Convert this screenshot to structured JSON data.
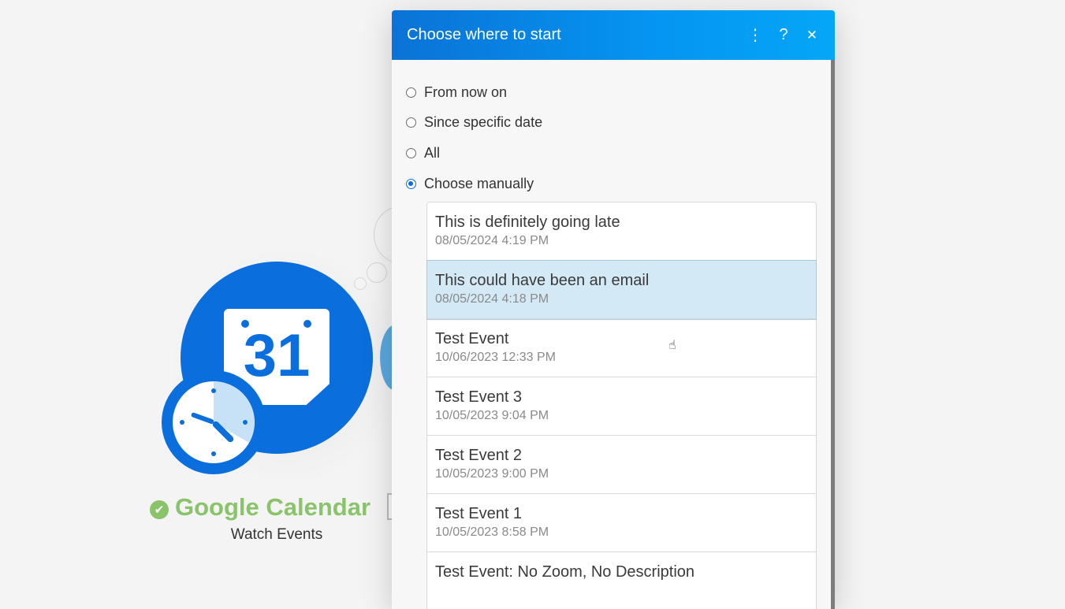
{
  "module": {
    "app_name": "Google Calendar",
    "action": "Watch Events",
    "calendar_day": "31",
    "status_icon": "check-circle-icon",
    "brand_color": "#0a6fdc",
    "status_color": "#8ac46a"
  },
  "dialog": {
    "title": "Choose where to start",
    "header_icons": [
      "more-vertical-icon",
      "help-icon",
      "close-icon"
    ],
    "header_glyphs": {
      "more": "⋮",
      "help": "?",
      "close": "✕"
    },
    "options": [
      {
        "label": "From now on",
        "checked": false
      },
      {
        "label": "Since specific date",
        "checked": false
      },
      {
        "label": "All",
        "checked": false
      },
      {
        "label": "Choose manually",
        "checked": true
      }
    ],
    "events": [
      {
        "title": "This is definitely going late",
        "date": "08/05/2024 4:19 PM",
        "selected": false
      },
      {
        "title": "This could have been an email",
        "date": "08/05/2024 4:18 PM",
        "selected": true
      },
      {
        "title": "Test Event",
        "date": "10/06/2023 12:33 PM",
        "selected": false
      },
      {
        "title": "Test Event 3",
        "date": "10/05/2023 9:04 PM",
        "selected": false
      },
      {
        "title": "Test Event 2",
        "date": "10/05/2023 9:00 PM",
        "selected": false
      },
      {
        "title": "Test Event 1",
        "date": "10/05/2023 8:58 PM",
        "selected": false
      },
      {
        "title": "Test Event: No Zoom, No Description",
        "date": "",
        "selected": false
      }
    ],
    "header_gradient": [
      "#0a73d6",
      "#05a6f7"
    ],
    "selection_color": "#d3e9f5"
  }
}
